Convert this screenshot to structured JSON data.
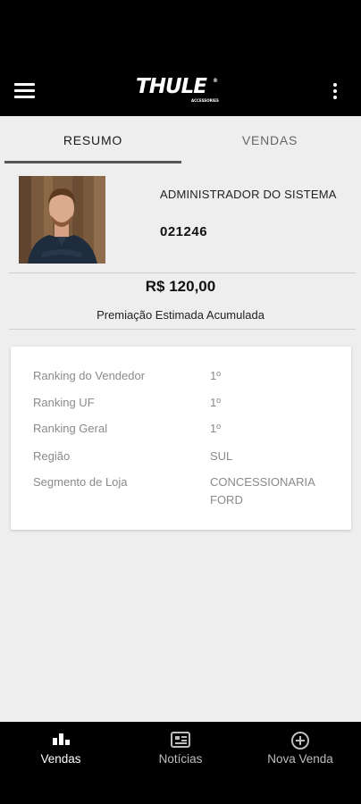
{
  "app": {
    "logo_text": "THULE",
    "logo_sub": "ACCESSORIES",
    "logo_mark": "®"
  },
  "tabs": [
    {
      "label": "RESUMO"
    },
    {
      "label": "VENDAS"
    }
  ],
  "user": {
    "name": "ADMINISTRADOR DO SISTEMA",
    "code": "021246"
  },
  "summary": {
    "amount": "R$ 120,00",
    "amount_label": "Premiação Estimada Acumulada"
  },
  "details": [
    {
      "label": "Ranking do Vendedor",
      "value": "1º"
    },
    {
      "label": "Ranking UF",
      "value": "1º"
    },
    {
      "label": "Ranking Geral",
      "value": "1º"
    },
    {
      "label": "Região",
      "value": "SUL"
    },
    {
      "label": "Segmento de Loja",
      "value": "CONCESSIONARIA FORD"
    }
  ],
  "bottom_nav": [
    {
      "label": "Vendas",
      "icon": "bar-chart-icon"
    },
    {
      "label": "Notícias",
      "icon": "newspaper-icon"
    },
    {
      "label": "Nova Venda",
      "icon": "add-circle-icon"
    }
  ],
  "colors": {
    "bar": "#000000",
    "background": "#eeeeee",
    "active_nav": "#ffffff",
    "inactive_nav": "#bdbdbd"
  }
}
